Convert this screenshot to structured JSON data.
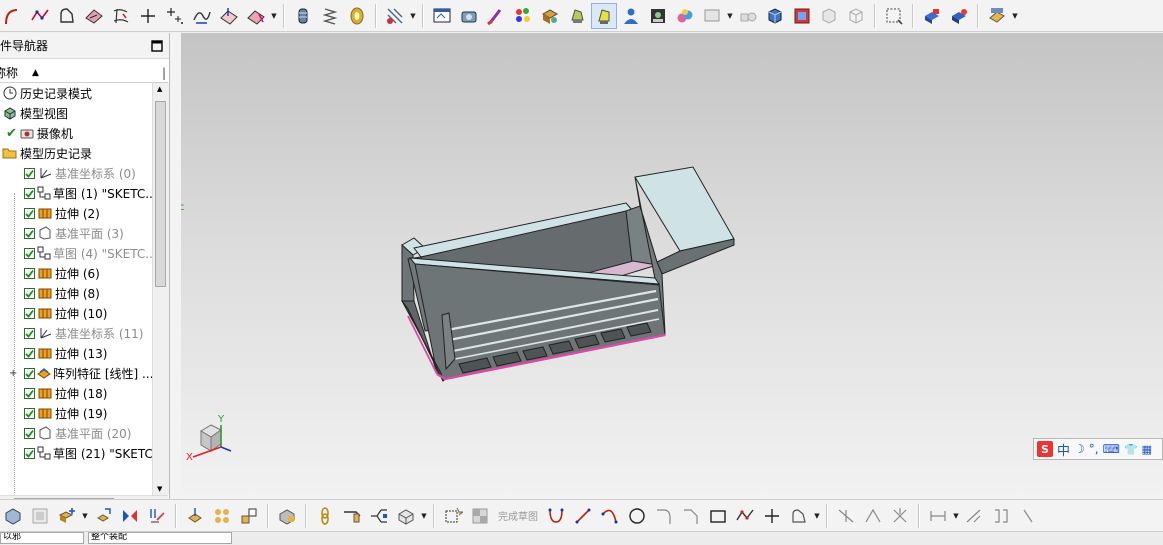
{
  "navigator": {
    "title": "件导航器",
    "column_name": "称称",
    "items": [
      {
        "label": "历史记录模式",
        "icon": "clock-icon",
        "greyed": false,
        "check": false
      },
      {
        "label": "模型视图",
        "icon": "model-view-icon",
        "greyed": false,
        "check": false
      },
      {
        "label": "摄像机",
        "icon": "camera-icon",
        "greyed": false,
        "check": true
      },
      {
        "label": "模型历史记录",
        "icon": "folder-open-icon",
        "greyed": false,
        "check": false
      },
      {
        "label": "基准坐标系 (0)",
        "icon": "datum-csys-icon",
        "greyed": true,
        "check": true
      },
      {
        "label": "草图 (1) \"SKETC...",
        "icon": "sketch-icon",
        "greyed": false,
        "check": true
      },
      {
        "label": "拉伸 (2)",
        "icon": "extrude-icon",
        "greyed": false,
        "check": true
      },
      {
        "label": "基准平面 (3)",
        "icon": "datum-plane-icon",
        "greyed": true,
        "check": true
      },
      {
        "label": "草图 (4) \"SKETC...",
        "icon": "sketch-icon",
        "greyed": true,
        "check": true
      },
      {
        "label": "拉伸 (6)",
        "icon": "extrude-icon",
        "greyed": false,
        "check": true
      },
      {
        "label": "拉伸 (8)",
        "icon": "extrude-icon",
        "greyed": false,
        "check": true
      },
      {
        "label": "拉伸 (10)",
        "icon": "extrude-icon",
        "greyed": false,
        "check": true
      },
      {
        "label": "基准坐标系 (11)",
        "icon": "datum-csys-icon",
        "greyed": true,
        "check": true
      },
      {
        "label": "拉伸 (13)",
        "icon": "extrude-icon",
        "greyed": false,
        "check": true
      },
      {
        "label": "阵列特征 [线性] ...",
        "icon": "pattern-icon",
        "greyed": false,
        "check": true
      },
      {
        "label": "拉伸 (18)",
        "icon": "extrude-icon",
        "greyed": false,
        "check": true
      },
      {
        "label": "拉伸 (19)",
        "icon": "extrude-icon",
        "greyed": false,
        "check": true
      },
      {
        "label": "基准平面 (20)",
        "icon": "datum-plane-icon",
        "greyed": true,
        "check": true
      },
      {
        "label": "草图 (21) \"SKETC...",
        "icon": "sketch-icon",
        "greyed": false,
        "check": true
      }
    ]
  },
  "bottom_toolbar": {
    "finish_sketch_label": "完成草图"
  },
  "ime": {
    "mode_label": "中"
  },
  "axis": {
    "y": "Y",
    "x": "X"
  },
  "status": {
    "field1": "以邪",
    "field2": "整个装配"
  },
  "colors": {
    "body_grey": "#6e7576",
    "top_face": "#cfe3e6",
    "floor": "#d7b9cf",
    "accent_pink": "#d94aa2",
    "check_green": "#1a8a1a"
  }
}
